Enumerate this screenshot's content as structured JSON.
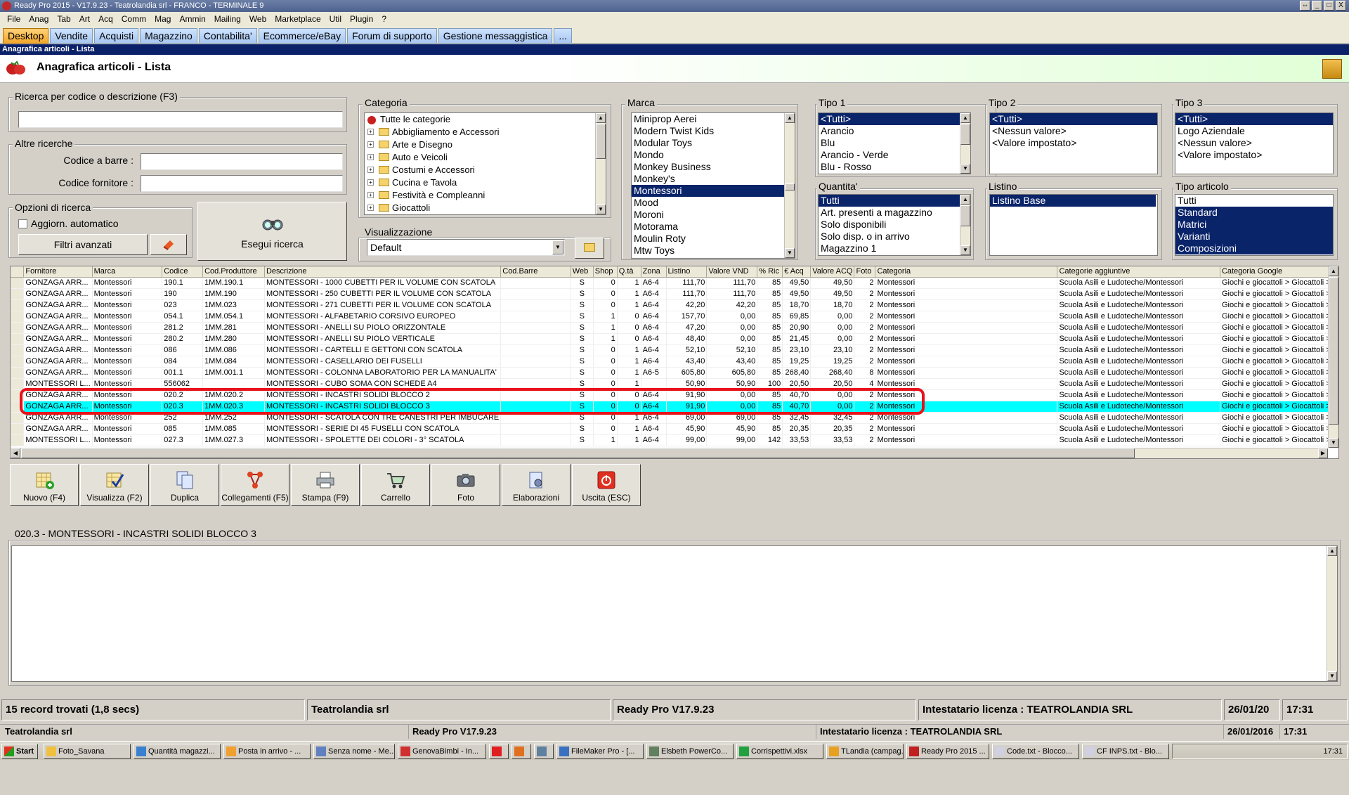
{
  "window": {
    "title": "Ready Pro 2015 - V17.9.23 - Teatrolandia srl - FRANCO - TERMINALE 9",
    "buttons": [
      "⇔",
      "_",
      "□",
      "X"
    ]
  },
  "menu": [
    "File",
    "Anag",
    "Tab",
    "Art",
    "Acq",
    "Comm",
    "Mag",
    "Ammin",
    "Mailing",
    "Web",
    "Marketplace",
    "Util",
    "Plugin",
    "?"
  ],
  "tabs": [
    "Desktop",
    "Vendite",
    "Acquisti",
    "Magazzino",
    "Contabilita'",
    "Ecommerce/eBay",
    "Forum di supporto",
    "Gestione messaggistica",
    "..."
  ],
  "breadcrumb": "Anagrafica articoli  - Lista",
  "page_title": "Anagrafica articoli  - Lista",
  "search": {
    "legend": "Ricerca per codice o descrizione (F3)",
    "value": "",
    "altre_legend": "Altre ricerche",
    "barcode_label": "Codice a barre :",
    "supplier_label": "Codice fornitore :",
    "options_legend": "Opzioni di ricerca",
    "auto_update_label": "Aggiorn. automatico",
    "advanced_filters": "Filtri avanzati",
    "execute": "Esegui ricerca"
  },
  "categoria": {
    "legend": "Categoria",
    "items": [
      "Tutte le categorie",
      "Abbigliamento e Accessori",
      "Arte e Disegno",
      "Auto e Veicoli",
      "Costumi e Accessori",
      "Cucina e Tavola",
      "Festività e Compleanni",
      "Giocattoli"
    ]
  },
  "visualizzazione": {
    "legend": "Visualizzazione",
    "value": "Default"
  },
  "marca": {
    "legend": "Marca",
    "items": [
      "Miniprop Aerei",
      "Modern Twist Kids",
      "Modular Toys",
      "Mondo",
      "Monkey Business",
      "Monkey's",
      "Montessori",
      "Mood",
      "Moroni",
      "Motorama",
      "Moulin Roty",
      "Mtw Toys"
    ],
    "selected": "Montessori"
  },
  "tipo1": {
    "legend": "Tipo 1",
    "items": [
      "<Tutti>",
      "Arancio",
      "Blu",
      "Arancio - Verde",
      "Blu - Rosso"
    ],
    "selected": "<Tutti>"
  },
  "tipo2": {
    "legend": "Tipo 2",
    "items": [
      "<Tutti>",
      "<Nessun valore>",
      "<Valore impostato>"
    ],
    "selected": "<Tutti>"
  },
  "tipo3": {
    "legend": "Tipo 3",
    "items": [
      "<Tutti>",
      "Logo Aziendale",
      "<Nessun valore>",
      "<Valore impostato>"
    ],
    "selected": "<Tutti>"
  },
  "quantita": {
    "legend": "Quantita'",
    "items": [
      "Tutti",
      "Art. presenti a magazzino",
      "Solo disponibili",
      "Solo disp. o in arrivo",
      "Magazzino 1"
    ],
    "selected": "Tutti"
  },
  "listino": {
    "legend": "Listino",
    "items": [
      "Listino Base"
    ],
    "selected": "Listino Base"
  },
  "tipo_articolo": {
    "legend": "Tipo articolo",
    "items": [
      "Tutti",
      "Standard",
      "Matrici",
      "Varianti",
      "Composizioni"
    ],
    "selected": [
      "Standard",
      "Matrici",
      "Varianti",
      "Composizioni"
    ]
  },
  "grid": {
    "columns": [
      "Fornitore",
      "Marca",
      "Codice",
      "Cod.Produttore",
      "Descrizione",
      "Cod.Barre",
      "Web",
      "Shop",
      "Q.tà",
      "Zona",
      "Listino",
      "Valore VND",
      "% Ric",
      "€ Acq",
      "Valore ACQ",
      "Foto",
      "Categoria",
      "Categorie aggiuntive",
      "Categoria Google"
    ],
    "rows": [
      [
        "GONZAGA ARR...",
        "Montessori",
        "190.1",
        "1MM.190.1",
        "MONTESSORI - 1000 CUBETTI PER IL VOLUME CON SCATOLA",
        "",
        "S",
        "0",
        "1",
        "A6-4",
        "111,70",
        "111,70",
        "85",
        "49,50",
        "49,50",
        "2",
        "Montessori",
        "Scuola Asili e Ludoteche/Montessori",
        "Giochi e giocattoli > Giocattoli >"
      ],
      [
        "GONZAGA ARR...",
        "Montessori",
        "190",
        "1MM.190",
        "MONTESSORI - 250 CUBETTI PER IL VOLUME CON SCATOLA",
        "",
        "S",
        "0",
        "1",
        "A6-4",
        "111,70",
        "111,70",
        "85",
        "49,50",
        "49,50",
        "2",
        "Montessori",
        "Scuola Asili e Ludoteche/Montessori",
        "Giochi e giocattoli > Giocattoli >"
      ],
      [
        "GONZAGA ARR...",
        "Montessori",
        "023",
        "1MM.023",
        "MONTESSORI - 271 CUBETTI PER IL VOLUME CON SCATOLA",
        "",
        "S",
        "0",
        "1",
        "A6-4",
        "42,20",
        "42,20",
        "85",
        "18,70",
        "18,70",
        "2",
        "Montessori",
        "Scuola Asili e Ludoteche/Montessori",
        "Giochi e giocattoli > Giocattoli >"
      ],
      [
        "GONZAGA ARR...",
        "Montessori",
        "054.1",
        "1MM.054.1",
        "MONTESSORI - ALFABETARIO CORSIVO EUROPEO",
        "",
        "S",
        "1",
        "0",
        "A6-4",
        "157,70",
        "0,00",
        "85",
        "69,85",
        "0,00",
        "2",
        "Montessori",
        "Scuola Asili e Ludoteche/Montessori",
        "Giochi e giocattoli > Giocattoli >"
      ],
      [
        "GONZAGA ARR...",
        "Montessori",
        "281.2",
        "1MM.281",
        "MONTESSORI - ANELLI SU PIOLO ORIZZONTALE",
        "",
        "S",
        "1",
        "0",
        "A6-4",
        "47,20",
        "0,00",
        "85",
        "20,90",
        "0,00",
        "2",
        "Montessori",
        "Scuola Asili e Ludoteche/Montessori",
        "Giochi e giocattoli > Giocattoli >"
      ],
      [
        "GONZAGA ARR...",
        "Montessori",
        "280.2",
        "1MM.280",
        "MONTESSORI - ANELLI SU PIOLO VERTICALE",
        "",
        "S",
        "1",
        "0",
        "A6-4",
        "48,40",
        "0,00",
        "85",
        "21,45",
        "0,00",
        "2",
        "Montessori",
        "Scuola Asili e Ludoteche/Montessori",
        "Giochi e giocattoli > Giocattoli >"
      ],
      [
        "GONZAGA ARR...",
        "Montessori",
        "086",
        "1MM.086",
        "MONTESSORI - CARTELLI E GETTONI CON SCATOLA",
        "",
        "S",
        "0",
        "1",
        "A6-4",
        "52,10",
        "52,10",
        "85",
        "23,10",
        "23,10",
        "2",
        "Montessori",
        "Scuola Asili e Ludoteche/Montessori",
        "Giochi e giocattoli > Giocattoli >"
      ],
      [
        "GONZAGA ARR...",
        "Montessori",
        "084",
        "1MM.084",
        "MONTESSORI - CASELLARIO DEI FUSELLI",
        "",
        "S",
        "0",
        "1",
        "A6-4",
        "43,40",
        "43,40",
        "85",
        "19,25",
        "19,25",
        "2",
        "Montessori",
        "Scuola Asili e Ludoteche/Montessori",
        "Giochi e giocattoli > Giocattoli >"
      ],
      [
        "GONZAGA ARR...",
        "Montessori",
        "001.1",
        "1MM.001.1",
        "MONTESSORI - COLONNA LABORATORIO PER LA MANUALITA'",
        "",
        "S",
        "0",
        "1",
        "A6-5",
        "605,80",
        "605,80",
        "85",
        "268,40",
        "268,40",
        "8",
        "Montessori",
        "Scuola Asili e Ludoteche/Montessori",
        "Giochi e giocattoli > Giocattoli >"
      ],
      [
        "MONTESSORI L...",
        "Montessori",
        "556062",
        "",
        "MONTESSORI - CUBO SOMA CON SCHEDE A4",
        "",
        "S",
        "0",
        "1",
        "",
        "50,90",
        "50,90",
        "100",
        "20,50",
        "20,50",
        "4",
        "Montessori",
        "Scuola Asili e Ludoteche/Montessori",
        "Giochi e giocattoli > Giocattoli >"
      ],
      [
        "GONZAGA ARR...",
        "Montessori",
        "020.2",
        "1MM.020.2",
        "MONTESSORI - INCASTRI SOLIDI BLOCCO 2",
        "",
        "S",
        "0",
        "0",
        "A6-4",
        "91,90",
        "0,00",
        "85",
        "40,70",
        "0,00",
        "2",
        "Montessori",
        "Scuola Asili e Ludoteche/Montessori",
        "Giochi e giocattoli > Giocattoli >"
      ],
      [
        "GONZAGA ARR...",
        "Montessori",
        "020.3",
        "1MM.020.3",
        "MONTESSORI - INCASTRI SOLIDI BLOCCO 3",
        "",
        "S",
        "0",
        "0",
        "A6-4",
        "91,90",
        "0,00",
        "85",
        "40,70",
        "0,00",
        "2",
        "Montessori",
        "Scuola Asili e Ludoteche/Montessori",
        "Giochi e giocattoli > Giocattoli >"
      ],
      [
        "GONZAGA ARR...",
        "Montessori",
        "252",
        "1MM.252",
        "MONTESSORI - SCATOLA CON TRE CANESTRI PER IMBUCARE",
        "",
        "S",
        "0",
        "1",
        "A6-4",
        "69,00",
        "69,00",
        "85",
        "32,45",
        "32,45",
        "2",
        "Montessori",
        "Scuola Asili e Ludoteche/Montessori",
        "Giochi e giocattoli > Giocattoli >"
      ],
      [
        "GONZAGA ARR...",
        "Montessori",
        "085",
        "1MM.085",
        "MONTESSORI - SERIE DI 45 FUSELLI CON SCATOLA",
        "",
        "S",
        "0",
        "1",
        "A6-4",
        "45,90",
        "45,90",
        "85",
        "20,35",
        "20,35",
        "2",
        "Montessori",
        "Scuola Asili e Ludoteche/Montessori",
        "Giochi e giocattoli > Giocattoli >"
      ],
      [
        "MONTESSORI L...",
        "Montessori",
        "027.3",
        "1MM.027.3",
        "MONTESSORI - SPOLETTE DEI COLORI - 3° SCATOLA",
        "",
        "S",
        "1",
        "1",
        "A6-4",
        "99,00",
        "99,00",
        "142",
        "33,53",
        "33,53",
        "2",
        "Montessori",
        "Scuola Asili e Ludoteche/Montessori",
        "Giochi e giocattoli > Giocattoli >"
      ]
    ],
    "selected_row": 11
  },
  "toolbar": [
    "Nuovo (F4)",
    "Visualizza (F2)",
    "Duplica",
    "Collegamenti (F5)",
    "Stampa (F9)",
    "Carrello",
    "Foto",
    "Elaborazioni",
    "Uscita (ESC)"
  ],
  "detail": {
    "legend": "020.3 - MONTESSORI - INCASTRI SOLIDI BLOCCO 3",
    "text": ""
  },
  "status": {
    "records": "15 record trovati (1,8 secs)",
    "company": "Teatrolandia srl",
    "version": "Ready Pro V17.9.23",
    "license": "Intestatario licenza : TEATROLANDIA SRL",
    "date": "26/01/20",
    "time": "17:31"
  },
  "status2": {
    "company": "Teatrolandia srl",
    "version": "Ready Pro V17.9.23",
    "license": "Intestatario licenza : TEATROLANDIA SRL",
    "date": "26/01/2016",
    "time": "17:31"
  },
  "taskbar": {
    "start": "Start",
    "items": [
      "Foto_Savana",
      "Quantità magazzi...",
      "Posta in arrivo - ...",
      "Senza nome - Me...",
      "GenovaBimbi - In...",
      "",
      "",
      "",
      "FileMaker Pro - [...",
      "Elsbeth PowerCo...",
      "Corrispettivi.xlsx",
      "TLandia (campag...",
      "Ready Pro 2015 ...",
      "Code.txt - Blocco...",
      "CF INPS.txt - Blo..."
    ],
    "clock": "17:31"
  },
  "colors": {
    "selection": "#0a246a",
    "row_highlight": "#00ffff",
    "annotation": "#e8121b",
    "tab_active": "#f3a62b"
  }
}
